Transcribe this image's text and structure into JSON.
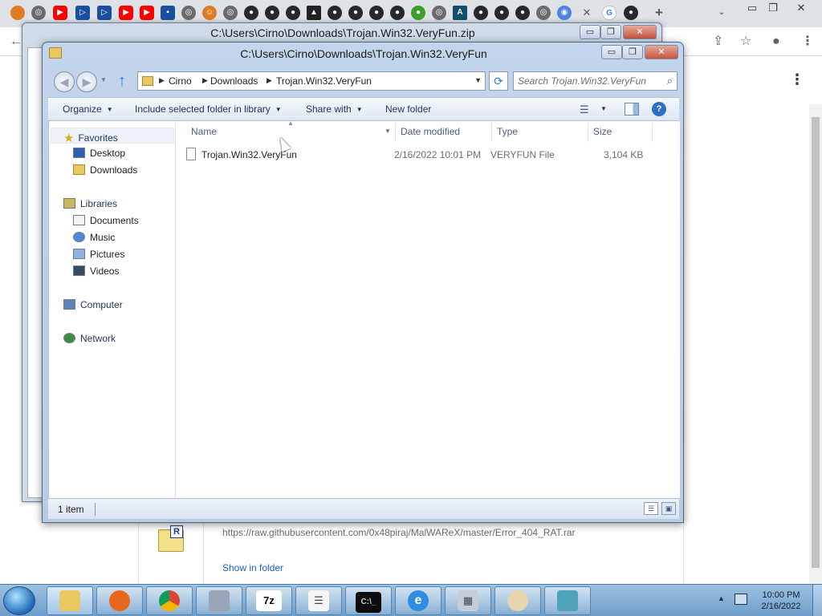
{
  "zip_window": {
    "title": "C:\\Users\\Cirno\\Downloads\\Trojan.Win32.VeryFun.zip",
    "controls": [
      "▭",
      "❐",
      "✕"
    ]
  },
  "explorer": {
    "title": "C:\\Users\\Cirno\\Downloads\\Trojan.Win32.VeryFun",
    "breadcrumbs": [
      "Cirno",
      "Downloads",
      "Trojan.Win32.VeryFun"
    ],
    "search_placeholder": "Search Trojan.Win32.VeryFun",
    "commands": {
      "organize": "Organize",
      "include_library": "Include selected folder in library",
      "share_with": "Share with",
      "new_folder": "New folder"
    },
    "nav": {
      "favorites": "Favorites",
      "desktop": "Desktop",
      "downloads": "Downloads",
      "libraries": "Libraries",
      "documents": "Documents",
      "music": "Music",
      "pictures": "Pictures",
      "videos": "Videos",
      "computer": "Computer",
      "network": "Network"
    },
    "columns": {
      "name": "Name",
      "date": "Date modified",
      "type": "Type",
      "size": "Size"
    },
    "files": [
      {
        "name": "Trojan.Win32.VeryFun",
        "date": "2/16/2022 10:01 PM",
        "type": "VERYFUN File",
        "size": "3,104 KB"
      }
    ],
    "status": "1 item"
  },
  "browser": {
    "download_url": "https://raw.githubusercontent.com/0x48piraj/MalWAReX/master/Error_404_RAT.rar",
    "show_in_folder": "Show in folder"
  },
  "taskbar": {
    "items": [
      "explorer",
      "firefox",
      "chrome",
      "tools",
      "7z",
      "tasks",
      "cmd",
      "ie",
      "calculator",
      "paint",
      "network"
    ],
    "sevenzip_label": "7z",
    "clock_time": "10:00 PM",
    "clock_date": "2/16/2022"
  }
}
